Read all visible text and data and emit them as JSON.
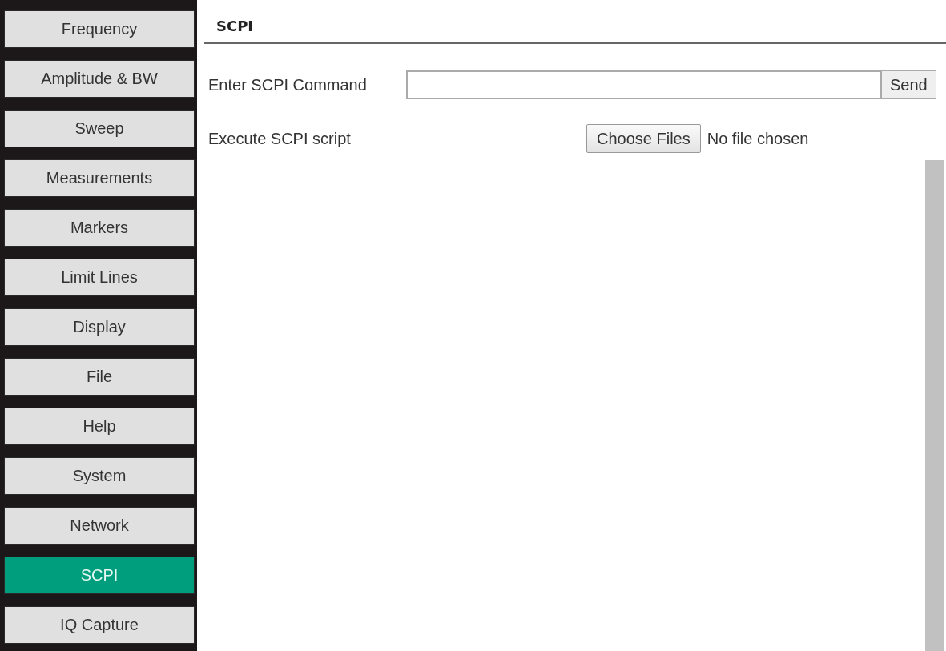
{
  "sidebar": {
    "items": [
      {
        "label": "Frequency",
        "selected": false
      },
      {
        "label": "Amplitude & BW",
        "selected": false
      },
      {
        "label": "Sweep",
        "selected": false
      },
      {
        "label": "Measurements",
        "selected": false
      },
      {
        "label": "Markers",
        "selected": false
      },
      {
        "label": "Limit Lines",
        "selected": false
      },
      {
        "label": "Display",
        "selected": false
      },
      {
        "label": "File",
        "selected": false
      },
      {
        "label": "Help",
        "selected": false
      },
      {
        "label": "System",
        "selected": false
      },
      {
        "label": "Network",
        "selected": false
      },
      {
        "label": "SCPI",
        "selected": true
      },
      {
        "label": "IQ Capture",
        "selected": false
      }
    ]
  },
  "panel": {
    "title": "SCPI",
    "command": {
      "label": "Enter SCPI Command",
      "button": "Send"
    },
    "script": {
      "label": "Execute SCPI script",
      "button": "Choose Files",
      "status": "No file chosen"
    }
  }
}
